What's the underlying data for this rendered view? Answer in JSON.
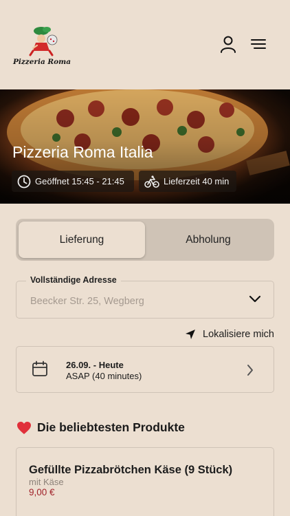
{
  "brand": {
    "logo_text": "Pizzeria Roma",
    "icons": {
      "user": "user-icon",
      "menu": "menu-icon"
    }
  },
  "hero": {
    "title": "Pizzeria Roma Italia",
    "opening": {
      "icon": "clock-icon",
      "text": "Geöffnet 15:45 - 21:45"
    },
    "delivery": {
      "icon": "bicycle-icon",
      "text": "Lieferzeit 40 min"
    }
  },
  "mode_toggle": {
    "options": [
      {
        "label": "Lieferung",
        "selected": true
      },
      {
        "label": "Abholung",
        "selected": false
      }
    ]
  },
  "address": {
    "label": "Vollständige Adresse",
    "placeholder": "Beecker Str. 25, Wegberg",
    "icon": "chevron-down-icon"
  },
  "locate": {
    "label": "Lokalisiere mich",
    "icon": "location-arrow-icon"
  },
  "schedule": {
    "date": "26.09. - Heute",
    "time": "ASAP (40 minutes)",
    "icons": {
      "calendar": "calendar-icon",
      "arrow": "chevron-right-icon"
    }
  },
  "popular": {
    "title": "Die beliebtesten Produkte",
    "icon": "heart-icon",
    "products": [
      {
        "name": "Gefüllte Pizzabrötchen Käse (9 Stück)",
        "description": "mit Käse",
        "price": "9,00 €"
      }
    ]
  },
  "colors": {
    "background": "#ecdfd1",
    "toggle_track": "#cfc3b6",
    "price": "#a0222a",
    "heart": "#e0303a"
  }
}
